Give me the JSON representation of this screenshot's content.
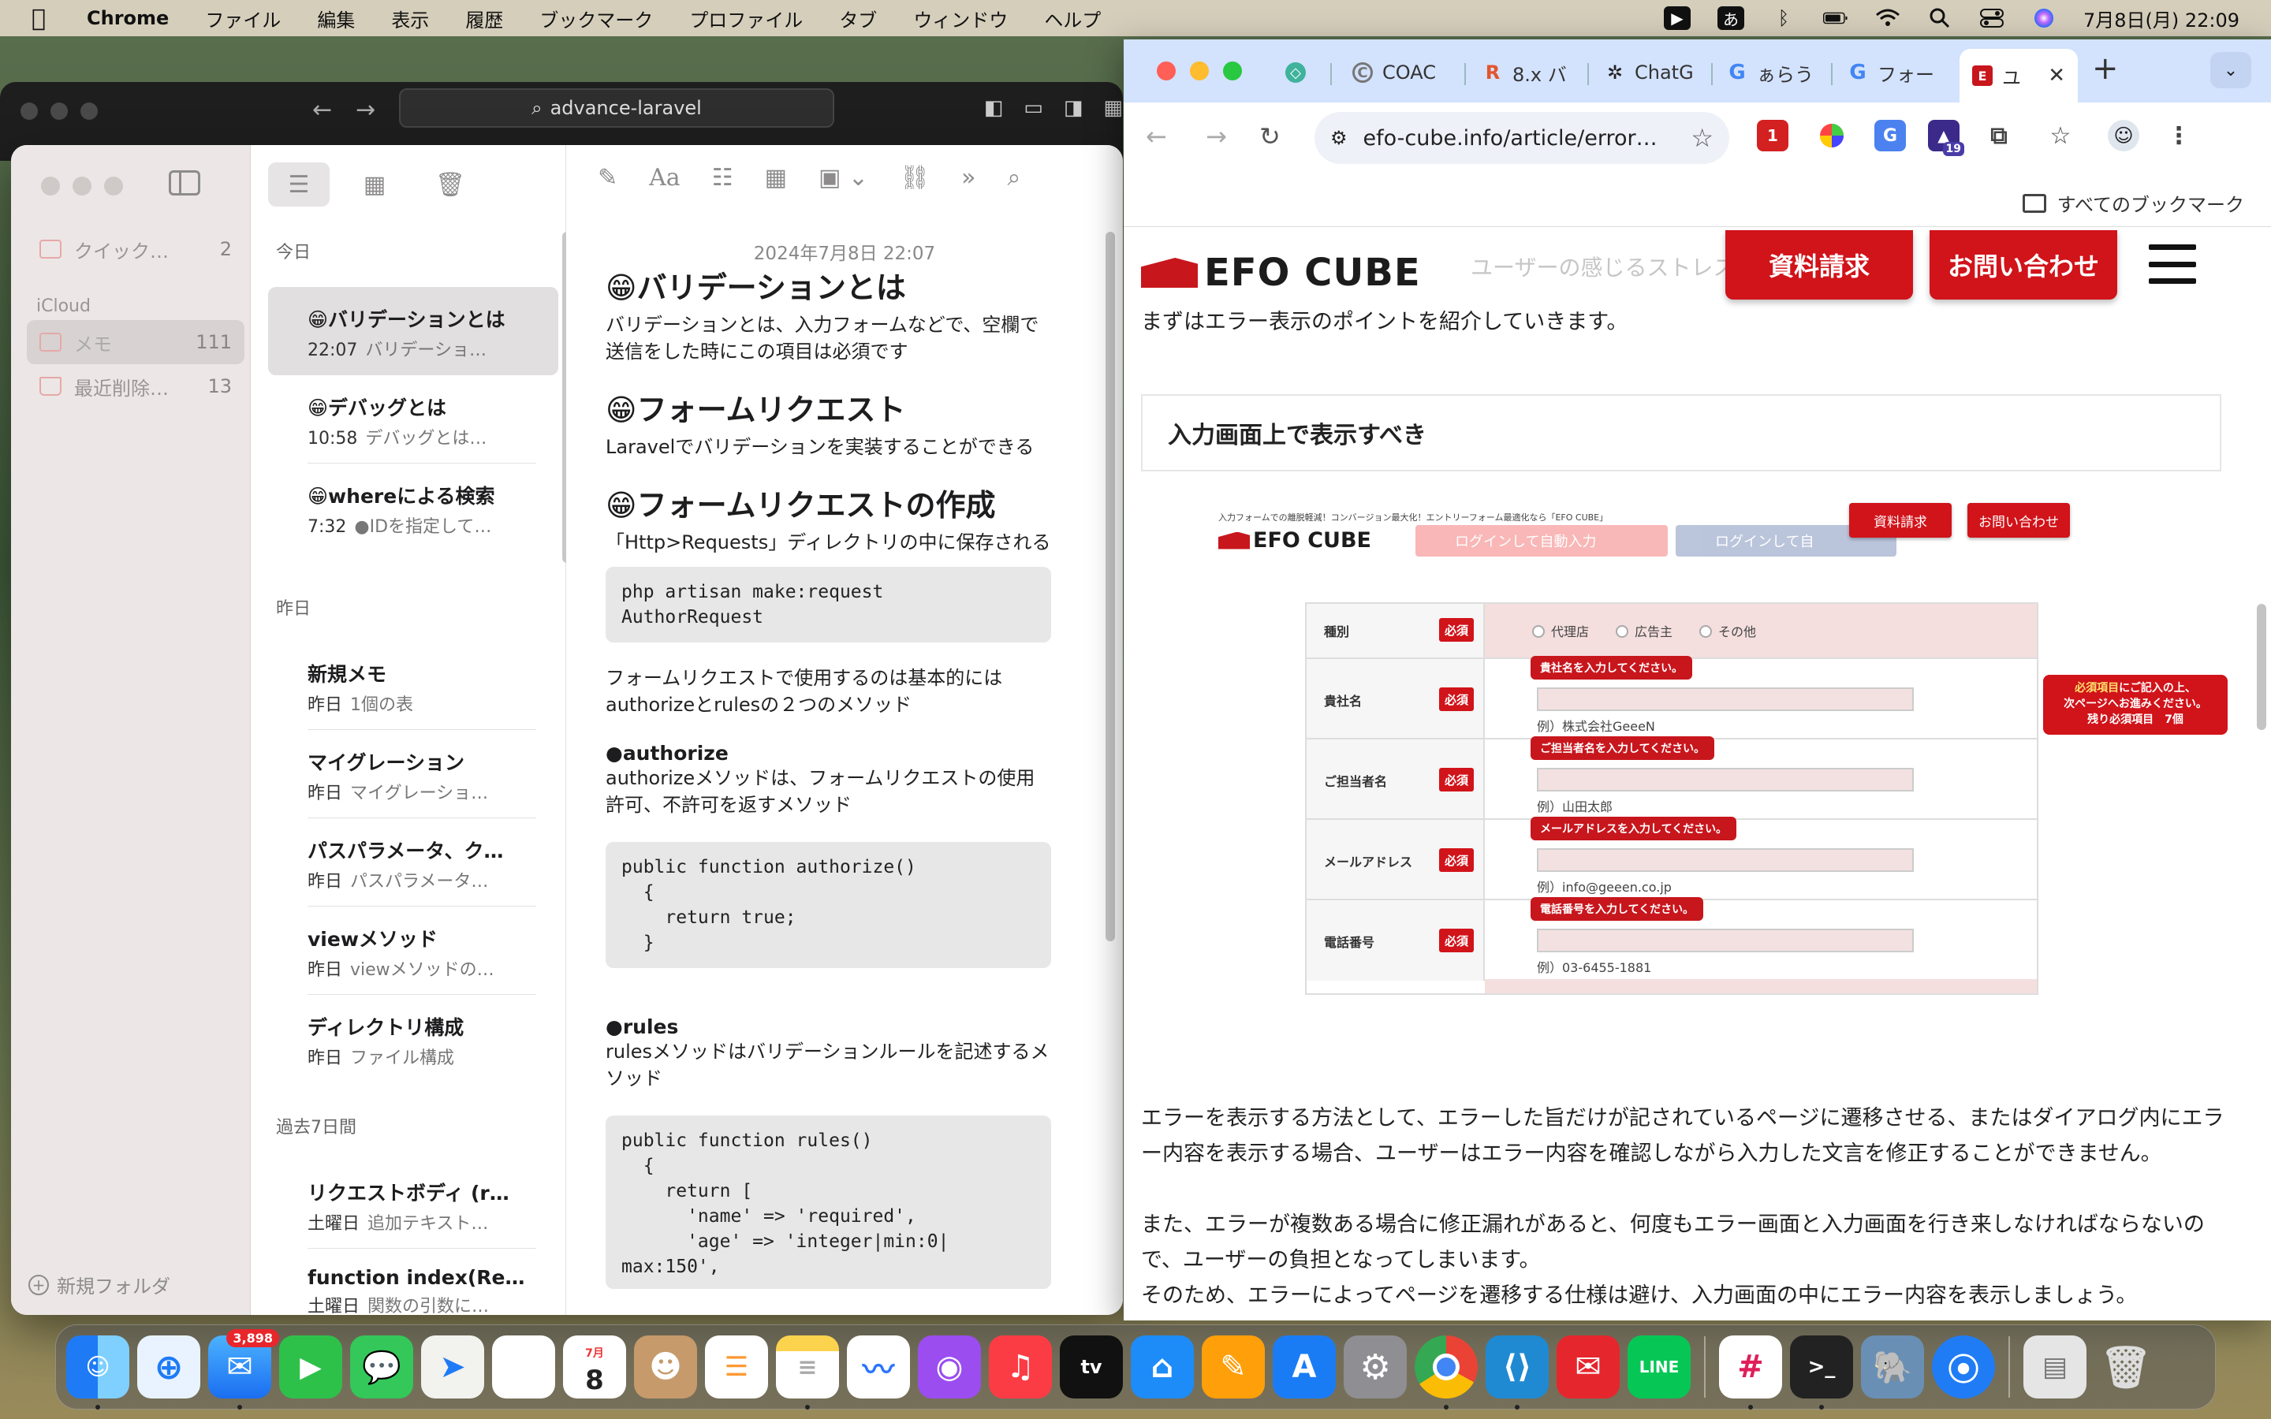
{
  "menubar": {
    "app": "Chrome",
    "items": [
      "ファイル",
      "編集",
      "表示",
      "履歴",
      "ブックマーク",
      "プロファイル",
      "タブ",
      "ウィンドウ",
      "ヘルプ"
    ],
    "input_method": "あ",
    "datetime": "7月8日(月)  22:09"
  },
  "bg_window": {
    "url": "advance-laravel"
  },
  "notes": {
    "sidebar": {
      "quick": {
        "label": "クイック…",
        "count": "2"
      },
      "icloud_heading": "iCloud",
      "memo": {
        "label": "メモ",
        "count": "111"
      },
      "deleted": {
        "label": "最近削除…",
        "count": "13"
      },
      "new_folder": "新規フォルダ"
    },
    "list": {
      "today": "今日",
      "yesterday": "昨日",
      "past7": "過去7日間",
      "items": [
        {
          "title": "😁バリデーションとは",
          "time": "22:07",
          "preview": "バリデーショ…"
        },
        {
          "title": "😁デバッグとは",
          "time": "10:58",
          "preview": "デバッグとは…"
        },
        {
          "title": "😁whereによる検索",
          "time": "7:32",
          "preview": "●IDを指定して…"
        },
        {
          "title": "新規メモ",
          "time": "昨日",
          "preview": "1個の表"
        },
        {
          "title": "マイグレーション",
          "time": "昨日",
          "preview": "マイグレーショ…"
        },
        {
          "title": "パスパラメータ、ク…",
          "time": "昨日",
          "preview": "パスパラメータ…"
        },
        {
          "title": "viewメソッド",
          "time": "昨日",
          "preview": "viewメソッドの…"
        },
        {
          "title": "ディレクトリ構成",
          "time": "昨日",
          "preview": "ファイル構成"
        },
        {
          "title": "リクエストボディ (r…",
          "time": "土曜日",
          "preview": "追加テキスト…"
        },
        {
          "title": "function index(Re…",
          "time": "土曜日",
          "preview": "関数の引数に…"
        }
      ]
    },
    "content": {
      "date": "2024年7月8日 22:07",
      "h1": "😁バリデーションとは",
      "p1": "バリデーションとは、入力フォームなどで、空欄で送信をした時にこの項目は必須です",
      "h2": "😁フォームリクエスト",
      "p2": "Laravelでバリデーションを実装することができる",
      "h3": "😁フォームリクエストの作成",
      "p3": "「Http>Requests」ディレクトリの中に保存される",
      "code1": "php artisan make:request\nAuthorRequest",
      "p4": "フォームリクエストで使用するのは基本的には\nauthorizeとrulesの２つのメソッド",
      "auth_h": "●authorize",
      "auth_p": "authorizeメソッドは、フォームリクエストの使用許可、不許可を返すメソッド",
      "code2": "public function authorize()\n  {\n    return true;\n  }",
      "rules_h": "●rules",
      "rules_p": "rulesメソッドはバリデーションルールを記述するメソッド",
      "code3": "public function rules()\n  {\n    return [\n      'name' => 'required',\n      'age' => 'integer|min:0|\nmax:150',"
    }
  },
  "chrome": {
    "tabs": [
      {
        "label": "",
        "fav": "◇",
        "color": "#3fb39c"
      },
      {
        "label": "COAC",
        "fav": "C",
        "color": "#777"
      },
      {
        "label": "8.x バ",
        "fav": "R",
        "color": "#e2552d"
      },
      {
        "label": "ChatG",
        "fav": "✲",
        "color": "#222"
      },
      {
        "label": "ぁらう",
        "fav": "G",
        "color": "#4285f4"
      },
      {
        "label": "フォー",
        "fav": "G",
        "color": "#4285f4"
      },
      {
        "label": "ユ",
        "fav": "E",
        "color": "#c8161d"
      }
    ],
    "url": "efo-cube.info/article/error…",
    "bookmarks_label": "すべてのブックマーク",
    "ext_badge": "19",
    "page": {
      "logo": "EFO CUBE",
      "behind_text": "ユーザーの感じるストレスは大",
      "btn_request": "資料請求",
      "btn_contact": "お問い合わせ",
      "intro": "まずはエラー表示のポイントを紹介していきます。",
      "section_title": "入力画面上で表示すべき",
      "mock": {
        "tagline": "入力フォームでの離脱軽減！コンバージョン最大化！エントリーフォーム最適化なら「EFO CUBE」",
        "logo": "EFO CUBE",
        "yahoo": "ログインして自動入力",
        "facebook": "ログインして自",
        "btn_request": "資料請求",
        "btn_contact": "お問い合わせ",
        "required": "必須",
        "rows": [
          {
            "label": "種別"
          },
          {
            "label": "貴社名",
            "tip": "貴社名を入力してください。",
            "example": "例）株式会社GeeeN"
          },
          {
            "label": "ご担当者名",
            "tip": "ご担当者名を入力してください。",
            "example": "例）山田太郎"
          },
          {
            "label": "メールアドレス",
            "tip": "メールアドレスを入力してください。",
            "example": "例）info@geeen.co.jp"
          },
          {
            "label": "電話番号",
            "tip": "電話番号を入力してください。",
            "example": "例）03-6455-1881"
          }
        ],
        "radio": [
          "代理店",
          "広告主",
          "その他"
        ],
        "side_line1_a": "必須項目",
        "side_line1_b": "にご記入の上、",
        "side_line2": "次ページへお進みください。",
        "side_line3": "残り必須項目　7個"
      },
      "para1": "エラーを表示する方法として、エラーした旨だけが記されているページに遷移させる、またはダイアログ内にエラー内容を表示する場合、ユーザーはエラー内容を確認しながら入力した文言を修正することができません。",
      "para2": "また、エラーが複数ある場合に修正漏れがあると、何度もエラー画面と入力画面を行き来しなければならないので、ユーザーの負担となってしまいます。",
      "para3": "そのため、エラーによってページを遷移する仕様は避け、入力画面の中にエラー内容を表示しましょう。"
    }
  },
  "dock": {
    "mail_badge": "3,898",
    "calendar_month": "7月",
    "calendar_day": "8"
  }
}
